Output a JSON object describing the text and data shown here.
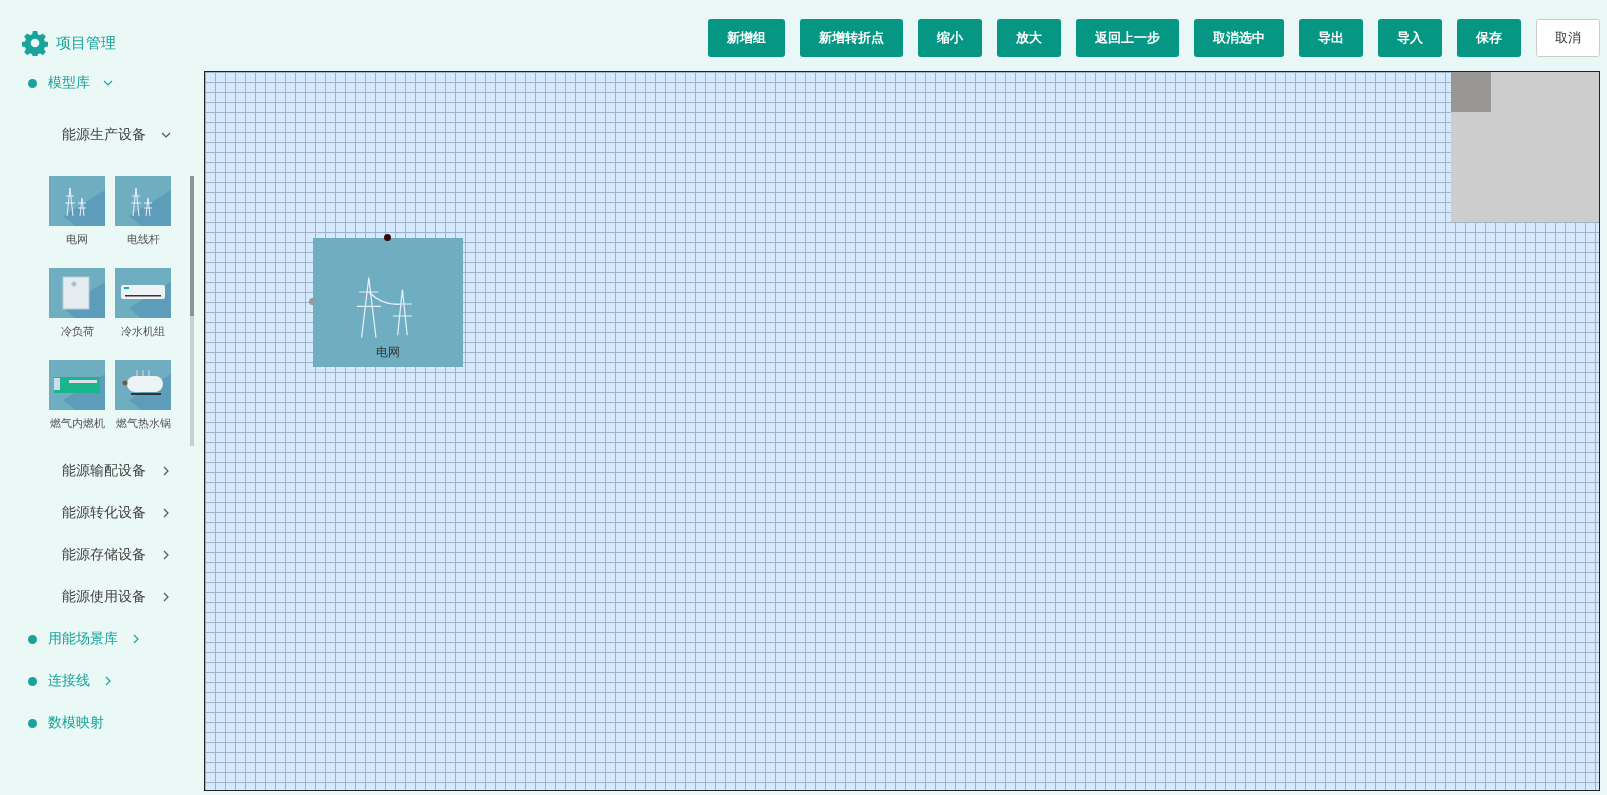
{
  "header": {
    "title": "项目管理"
  },
  "toolbar": [
    {
      "label": "新增组",
      "kind": "primary"
    },
    {
      "label": "新增转折点",
      "kind": "primary"
    },
    {
      "label": "缩小",
      "kind": "primary"
    },
    {
      "label": "放大",
      "kind": "primary"
    },
    {
      "label": "返回上一步",
      "kind": "primary"
    },
    {
      "label": "取消选中",
      "kind": "primary"
    },
    {
      "label": "导出",
      "kind": "primary"
    },
    {
      "label": "导入",
      "kind": "primary"
    },
    {
      "label": "保存",
      "kind": "primary"
    },
    {
      "label": "取消",
      "kind": "plain"
    }
  ],
  "sidebar": {
    "sections": [
      {
        "label": "模型库",
        "expanded": true,
        "groups": [
          {
            "label": "能源生产设备",
            "expanded": true,
            "items": [
              {
                "label": "电网",
                "kind": "grid"
              },
              {
                "label": "电线杆",
                "kind": "pole"
              },
              {
                "label": "冷负荷",
                "kind": "cold-load"
              },
              {
                "label": "冷水机组",
                "kind": "chiller"
              },
              {
                "label": "燃气内燃机",
                "kind": "gas-engine"
              },
              {
                "label": "燃气热水锅",
                "kind": "boiler"
              }
            ]
          },
          {
            "label": "能源输配设备",
            "expanded": false
          },
          {
            "label": "能源转化设备",
            "expanded": false
          },
          {
            "label": "能源存储设备",
            "expanded": false
          },
          {
            "label": "能源使用设备",
            "expanded": false
          }
        ]
      },
      {
        "label": "用能场景库",
        "expanded": false
      },
      {
        "label": "连接线",
        "expanded": false
      },
      {
        "label": "数模映射"
      }
    ]
  },
  "canvas": {
    "nodes": [
      {
        "label": "电网",
        "kind": "grid"
      }
    ]
  }
}
